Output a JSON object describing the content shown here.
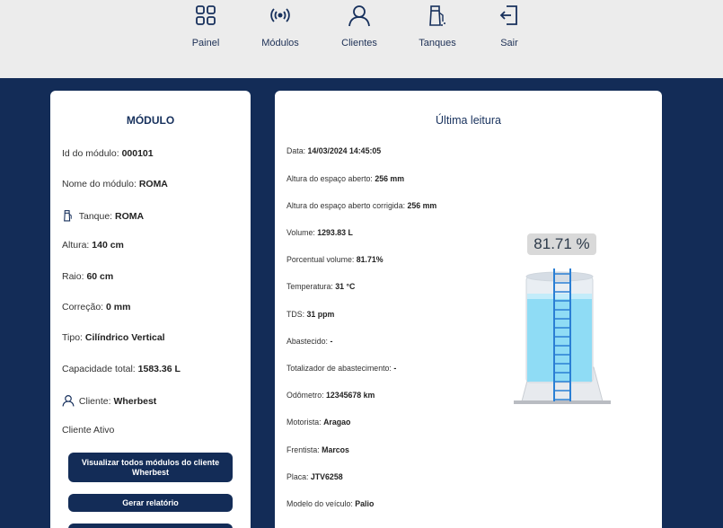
{
  "nav": {
    "items": [
      {
        "label": "Painel",
        "icon": "grid-icon"
      },
      {
        "label": "Módulos",
        "icon": "broadcast-icon"
      },
      {
        "label": "Clientes",
        "icon": "user-icon"
      },
      {
        "label": "Tanques",
        "icon": "fuel-pump-icon"
      },
      {
        "label": "Sair",
        "icon": "logout-icon"
      }
    ]
  },
  "module": {
    "title": "MÓDULO",
    "rows": [
      {
        "label": "Id do módulo:",
        "value": "000101"
      },
      {
        "label": "Nome do módulo:",
        "value": "ROMA"
      },
      {
        "label": "Tanque:",
        "value": "ROMA"
      },
      {
        "label": "Altura:",
        "value": "140 cm"
      },
      {
        "label": "Raio:",
        "value": "60 cm"
      },
      {
        "label": "Correção:",
        "value": "0 mm"
      },
      {
        "label": "Tipo:",
        "value": "Cilíndrico Vertical"
      },
      {
        "label": "Capacidade total:",
        "value": "1583.36 L"
      },
      {
        "label": "Cliente:",
        "value": "Wherbest"
      }
    ],
    "status": "Cliente Ativo",
    "buttons": {
      "view_all": "Visualizar todos módulos do cliente Wherbest",
      "report": "Gerar relatório"
    }
  },
  "reading": {
    "title": "Última leitura",
    "rows": [
      {
        "label": "Data:",
        "value": "14/03/2024 14:45:05"
      },
      {
        "label": "Altura do espaço aberto:",
        "value": "256 mm"
      },
      {
        "label": "Altura do espaço aberto corrigida:",
        "value": "256 mm"
      },
      {
        "label": "Volume:",
        "value": "1293.83 L"
      },
      {
        "label": "Porcentual volume:",
        "value": "81.71%"
      },
      {
        "label": "Temperatura:",
        "value": "31 °C"
      },
      {
        "label": "TDS:",
        "value": "31 ppm"
      },
      {
        "label": "Abastecido:",
        "value": "-"
      },
      {
        "label": "Totalizador de abastecimento:",
        "value": "-"
      },
      {
        "label": "Odômetro:",
        "value": "12345678 km"
      },
      {
        "label": "Motorista:",
        "value": "Aragao"
      },
      {
        "label": "Frentista:",
        "value": "Marcos"
      },
      {
        "label": "Placa:",
        "value": "JTV6258"
      },
      {
        "label": "Modelo do veículo:",
        "value": "Palio"
      }
    ],
    "percent_label": "81.71 %",
    "fill_fraction": 0.8171
  },
  "colors": {
    "navy": "#132c57",
    "water": "#8fdcf5",
    "ladder": "#2a7fd4"
  }
}
